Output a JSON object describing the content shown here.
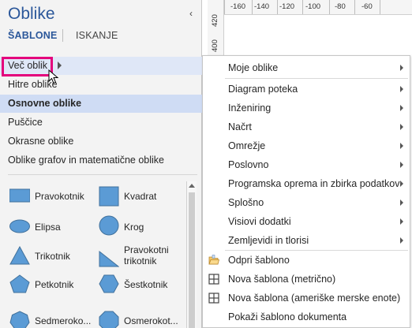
{
  "pane": {
    "title": "Oblike",
    "collapse_glyph": "‹",
    "tabs": [
      {
        "label": "ŠABLONE",
        "active": true
      },
      {
        "label": "ISKANJE",
        "active": false
      }
    ],
    "stencils": [
      {
        "label": "Več oblik",
        "state": "selected",
        "has_submenu": true
      },
      {
        "label": "Hitre oblike",
        "state": "normal"
      },
      {
        "label": "Osnovne oblike",
        "state": "active"
      },
      {
        "label": "Puščice",
        "state": "normal"
      },
      {
        "label": "Okrasne oblike",
        "state": "normal"
      },
      {
        "label": "Oblike grafov in matematične oblike",
        "state": "normal"
      }
    ],
    "shapes": [
      {
        "label": "Pravokotnik",
        "icon": "rectangle-icon"
      },
      {
        "label": "Kvadrat",
        "icon": "square-icon"
      },
      {
        "label": "Elipsa",
        "icon": "ellipse-icon"
      },
      {
        "label": "Krog",
        "icon": "circle-icon"
      },
      {
        "label": "Trikotnik",
        "icon": "triangle-icon"
      },
      {
        "label": "Pravokotni trikotnik",
        "label_lines": [
          "Pravokotni",
          "trikotnik"
        ],
        "icon": "right-triangle-icon"
      },
      {
        "label": "Petkotnik",
        "icon": "pentagon-icon"
      },
      {
        "label": "Šestkotnik",
        "icon": "hexagon-icon"
      },
      {
        "label": "Sedmerokotnik",
        "display": "Sedmeroko...",
        "icon": "heptagon-icon"
      },
      {
        "label": "Osmerokotnik",
        "display": "Osmerokot...",
        "icon": "octagon-icon"
      }
    ]
  },
  "ruler": {
    "h_ticks": [
      "-160",
      "-140",
      "-120",
      "-100",
      "-80",
      "-60"
    ],
    "v_ticks": [
      "420",
      "400"
    ]
  },
  "menu": {
    "items": [
      {
        "label": "Moje oblike",
        "submenu": true
      },
      {
        "label": "Diagram poteka",
        "submenu": true
      },
      {
        "label": "Inženiring",
        "submenu": true
      },
      {
        "label": "Načrt",
        "submenu": true
      },
      {
        "label": "Omrežje",
        "submenu": true
      },
      {
        "label": "Poslovno",
        "submenu": true
      },
      {
        "label": "Programska oprema in zbirka podatkov",
        "submenu": true
      },
      {
        "label": "Splošno",
        "submenu": true
      },
      {
        "label": "Visiovi dodatki",
        "submenu": true
      },
      {
        "label": "Zemljevidi in tlorisi",
        "submenu": true
      },
      {
        "label": "Odpri šablono",
        "icon": "open-folder-icon"
      },
      {
        "label": "Nova šablona (metrično)",
        "icon": "new-stencil-icon"
      },
      {
        "label": "Nova šablona (ameriške merske enote)",
        "icon": "new-stencil-icon"
      },
      {
        "label": "Pokaži šablono dokumenta"
      }
    ]
  },
  "colors": {
    "accent": "#2b579a",
    "shape_fill": "#5b9bd5",
    "highlight": "#e4007c",
    "selected_bg": "#cfdcf4"
  }
}
